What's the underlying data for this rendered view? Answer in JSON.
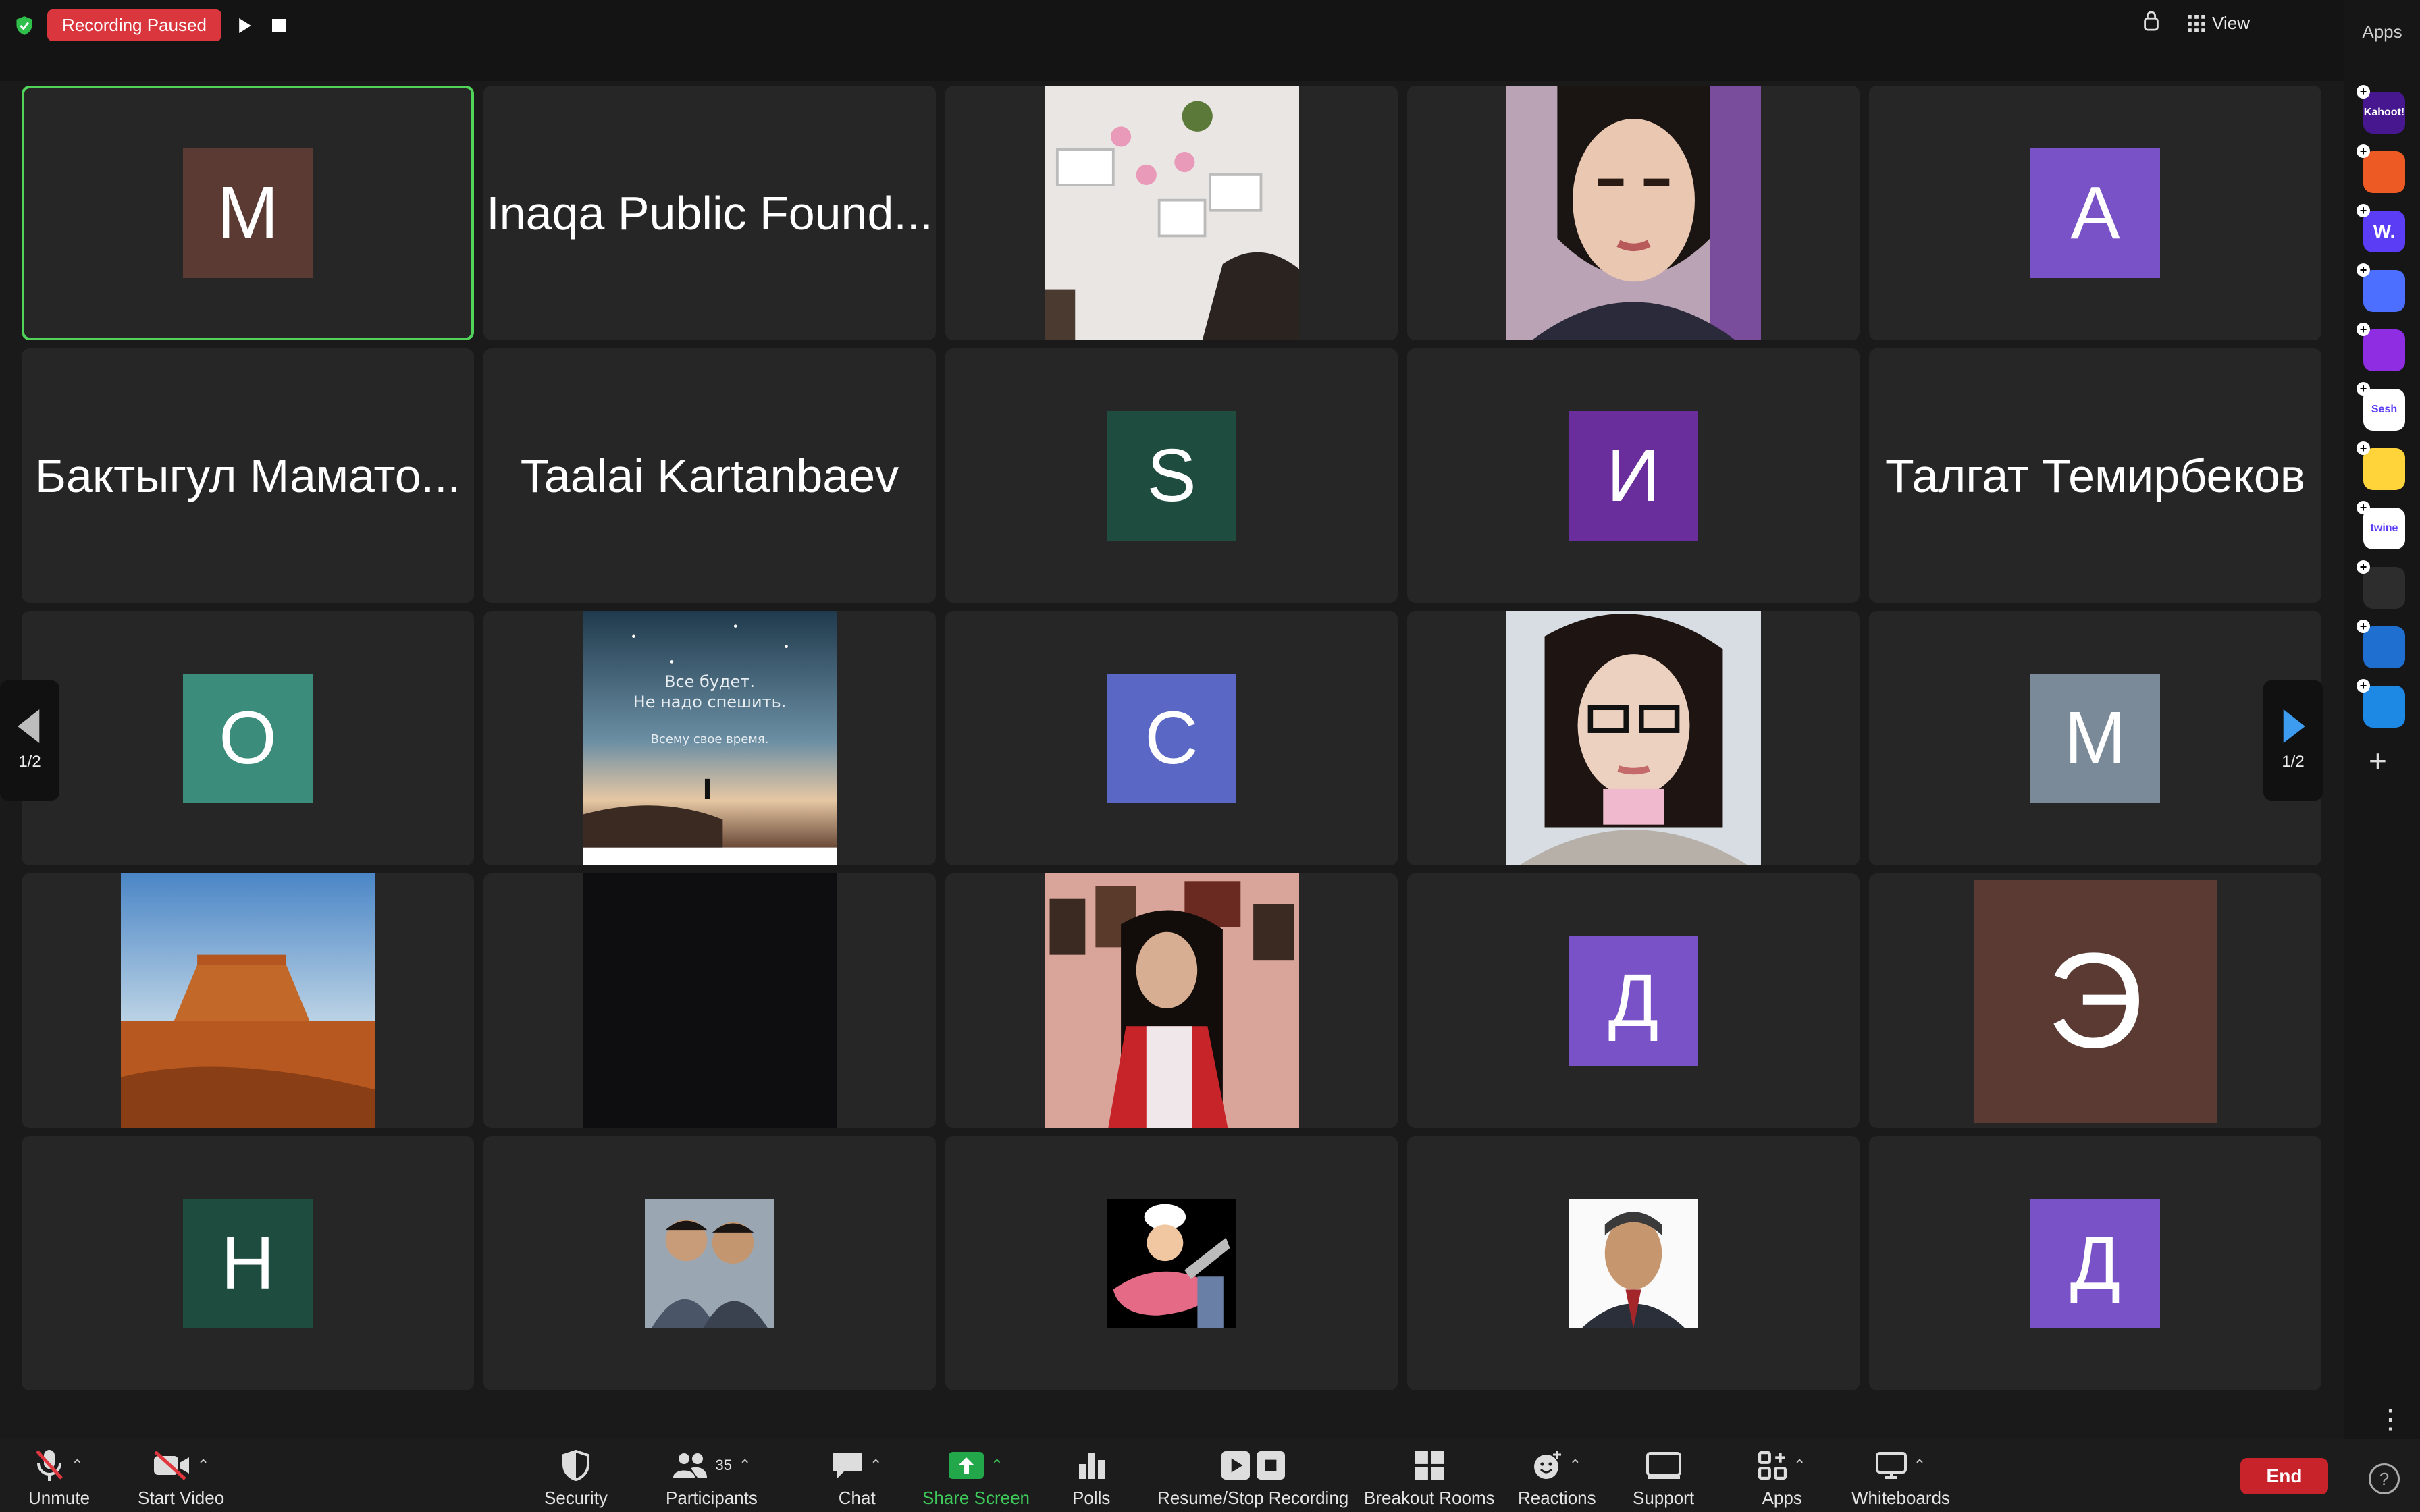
{
  "recording": {
    "status_label": "Recording Paused"
  },
  "top_right": {
    "view_label": "View"
  },
  "apps_rail": {
    "title": "Apps",
    "apps": [
      {
        "label": "Kahoot!",
        "color": "#46178f"
      },
      {
        "label": "",
        "color": "#ee5a24"
      },
      {
        "label": "W.",
        "color": "#5b3df5"
      },
      {
        "label": "",
        "color": "#4c6fff"
      },
      {
        "label": "",
        "color": "#8e2de2"
      },
      {
        "label": "Sesh",
        "color": "#ffffff"
      },
      {
        "label": "",
        "color": "#ffd43b"
      },
      {
        "label": "twine",
        "color": "#ffffff"
      },
      {
        "label": "",
        "color": "#2d2d2d"
      },
      {
        "label": "",
        "color": "#1f6fd1"
      },
      {
        "label": "",
        "color": "#1e88e5"
      }
    ]
  },
  "pager": {
    "left_label": "1/2",
    "right_label": "1/2"
  },
  "participants": [
    {
      "type": "avatar",
      "initial": "M",
      "color": "#5b3a33",
      "active": true
    },
    {
      "type": "name",
      "name": "Inaqa Public Found..."
    },
    {
      "type": "photo",
      "icon": "wall-photo-icon"
    },
    {
      "type": "photo",
      "icon": "woman-portrait-icon"
    },
    {
      "type": "avatar",
      "initial": "A",
      "color": "#7a52c7"
    },
    {
      "type": "name",
      "name": "Бактыгул Мамато..."
    },
    {
      "type": "name",
      "name": "Taalai Kartanbaev"
    },
    {
      "type": "avatar",
      "initial": "S",
      "color": "#1e4d3f"
    },
    {
      "type": "avatar",
      "initial": "И",
      "color": "#6a2e9c"
    },
    {
      "type": "name",
      "name": "Талгат Темирбеков"
    },
    {
      "type": "avatar",
      "initial": "O",
      "color": "#3c8c7c"
    },
    {
      "type": "photo",
      "icon": "starry-sky-quote-icon",
      "quote": [
        "Все будет.",
        "Не надо спешить.",
        "Всему свое время."
      ]
    },
    {
      "type": "avatar",
      "initial": "C",
      "color": "#5a67c4"
    },
    {
      "type": "photo",
      "icon": "woman-glasses-portrait-icon"
    },
    {
      "type": "avatar",
      "initial": "M",
      "color": "#7a8a99"
    },
    {
      "type": "photo",
      "icon": "desert-mesa-icon"
    },
    {
      "type": "photo",
      "icon": "dark-image-icon"
    },
    {
      "type": "photo",
      "icon": "woman-red-jacket-icon"
    },
    {
      "type": "avatar",
      "initial": "Д",
      "color": "#7a52c7"
    },
    {
      "type": "avatar",
      "initial": "Э",
      "color": "#5b3a33",
      "big": true
    },
    {
      "type": "avatar",
      "initial": "H",
      "color": "#1e4d3f"
    },
    {
      "type": "photo",
      "icon": "two-men-photo-icon",
      "small": true
    },
    {
      "type": "photo",
      "icon": "chef-cartoon-icon",
      "small": true
    },
    {
      "type": "photo",
      "icon": "man-portrait-icon",
      "small": true
    },
    {
      "type": "avatar",
      "initial": "Д",
      "color": "#7a52c7"
    }
  ],
  "toolbar": {
    "unmute": "Unmute",
    "start_video": "Start Video",
    "security": "Security",
    "participants": "Participants",
    "participants_count": "35",
    "chat": "Chat",
    "share_screen": "Share Screen",
    "polls": "Polls",
    "recording": "Resume/Stop Recording",
    "breakout": "Breakout Rooms",
    "reactions": "Reactions",
    "support": "Support",
    "apps": "Apps",
    "whiteboards": "Whiteboards",
    "end": "End"
  }
}
